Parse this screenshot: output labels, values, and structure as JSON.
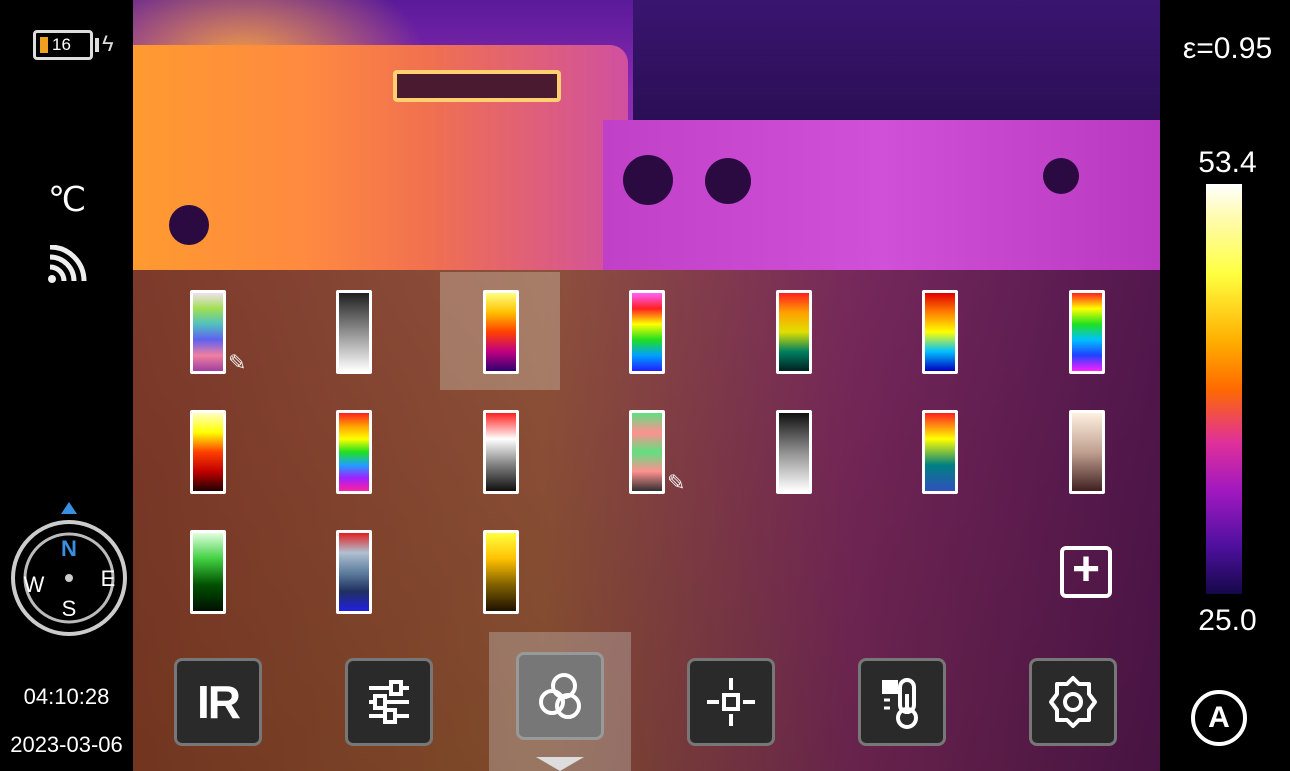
{
  "status": {
    "battery_level": "16",
    "unit": "℃",
    "time": "04:10:28",
    "date": "2023-03-06"
  },
  "compass": {
    "north": "N",
    "south": "S",
    "east": "E",
    "west": "W"
  },
  "scale": {
    "emissivity": "ε=0.95",
    "max_temp": "53.4",
    "min_temp": "25.0",
    "mode": "A"
  },
  "palettes": [
    {
      "name": "custom-1",
      "editable": true,
      "stops": [
        "#f0e0f0",
        "#a0e050",
        "#50c0c0",
        "#6060f0",
        "#f080a0",
        "#a040a0"
      ]
    },
    {
      "name": "white-hot",
      "editable": false,
      "stops": [
        "#202020",
        "#909090",
        "#ffffff"
      ]
    },
    {
      "name": "iron",
      "editable": false,
      "selected": true,
      "stops": [
        "#ffff80",
        "#ffc000",
        "#ff4000",
        "#c00080",
        "#300070"
      ]
    },
    {
      "name": "rainbow",
      "editable": false,
      "stops": [
        "#ff60ff",
        "#ff2020",
        "#ffff00",
        "#20e020",
        "#00a0ff",
        "#2020ff"
      ]
    },
    {
      "name": "medical",
      "editable": false,
      "stops": [
        "#ff2020",
        "#ffa000",
        "#e0e000",
        "#008060",
        "#002020"
      ]
    },
    {
      "name": "rainbow-hc",
      "editable": false,
      "stops": [
        "#e00000",
        "#ff8000",
        "#ffff00",
        "#00c0ff",
        "#0000c0"
      ]
    },
    {
      "name": "contrast",
      "editable": false,
      "stops": [
        "#ff2020",
        "#ffff00",
        "#20e020",
        "#00c0ff",
        "#2040ff",
        "#ff20ff"
      ]
    },
    {
      "name": "red-hot",
      "editable": false,
      "stops": [
        "#ffffc0",
        "#ffff00",
        "#ff4000",
        "#c00000",
        "#200000"
      ]
    },
    {
      "name": "arctic-rainbow",
      "editable": false,
      "stops": [
        "#ff2020",
        "#ffa000",
        "#ffff00",
        "#20e020",
        "#20a0ff",
        "#a020ff",
        "#ff20a0"
      ]
    },
    {
      "name": "red-gray",
      "editable": false,
      "stops": [
        "#ff2020",
        "#ffffff",
        "#808080",
        "#101010"
      ]
    },
    {
      "name": "custom-2",
      "editable": true,
      "stops": [
        "#60e080",
        "#ff9090",
        "#60e080",
        "#ff9090",
        "#303030"
      ]
    },
    {
      "name": "black-hot",
      "editable": false,
      "stops": [
        "#101010",
        "#909090",
        "#ffffff"
      ]
    },
    {
      "name": "red-blue",
      "editable": false,
      "stops": [
        "#ff2020",
        "#ffff00",
        "#008080",
        "#3050c0"
      ]
    },
    {
      "name": "sepia",
      "editable": false,
      "stops": [
        "#fff0e0",
        "#c0a090",
        "#402020"
      ]
    },
    {
      "name": "green",
      "editable": false,
      "stops": [
        "#e0ffe0",
        "#40d040",
        "#005000",
        "#001000"
      ]
    },
    {
      "name": "blue-steel",
      "editable": false,
      "stops": [
        "#e02020",
        "#b0c0d0",
        "#6080a0",
        "#203060",
        "#2020e0"
      ]
    },
    {
      "name": "amber",
      "editable": false,
      "stops": [
        "#ffff40",
        "#ffc000",
        "#806000",
        "#201000"
      ]
    }
  ],
  "icons": {
    "add": "plus-icon",
    "edit": "pencil-icon"
  },
  "toolbar": {
    "ir_label": "IR",
    "items": [
      "ir-mode",
      "adjust",
      "palette",
      "measure-point",
      "temperature-settings",
      "settings"
    ],
    "selected": "palette"
  }
}
